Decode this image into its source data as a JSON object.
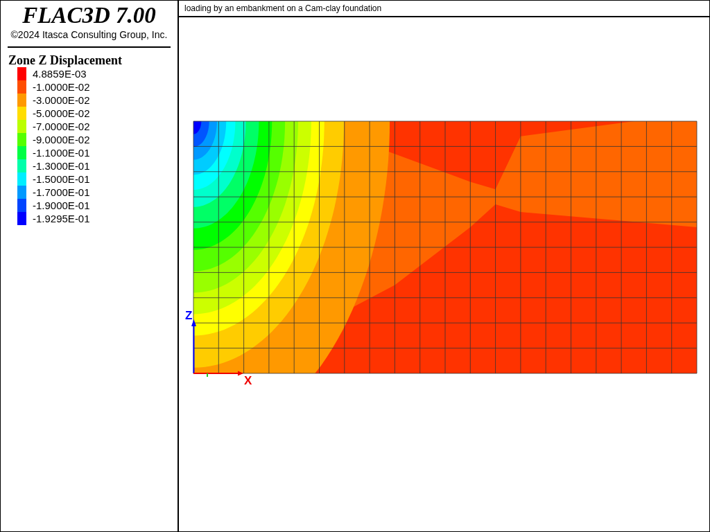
{
  "header": {
    "title": "FLAC3D 7.00",
    "copyright": "©2024 Itasca Consulting Group, Inc."
  },
  "legend": {
    "title": "Zone Z Displacement",
    "items": [
      {
        "label": "4.8859E-03",
        "color": "#ff0000"
      },
      {
        "label": "-1.0000E-02",
        "color": "#ff4d00"
      },
      {
        "label": "-3.0000E-02",
        "color": "#ff9900"
      },
      {
        "label": "-5.0000E-02",
        "color": "#ffdd00"
      },
      {
        "label": "-7.0000E-02",
        "color": "#bbff00"
      },
      {
        "label": "-9.0000E-02",
        "color": "#55ff00"
      },
      {
        "label": "-1.1000E-01",
        "color": "#00ff44"
      },
      {
        "label": "-1.3000E-01",
        "color": "#00ffaa"
      },
      {
        "label": "-1.5000E-01",
        "color": "#00eeff"
      },
      {
        "label": "-1.7000E-01",
        "color": "#0099ff"
      },
      {
        "label": "-1.9000E-01",
        "color": "#0044ff"
      },
      {
        "label": "-1.9295E-01",
        "color": "#0000ff"
      }
    ]
  },
  "plot": {
    "title": "loading by an embankment on a Cam-clay foundation",
    "axes": {
      "z": "Z",
      "x": "X"
    }
  }
}
